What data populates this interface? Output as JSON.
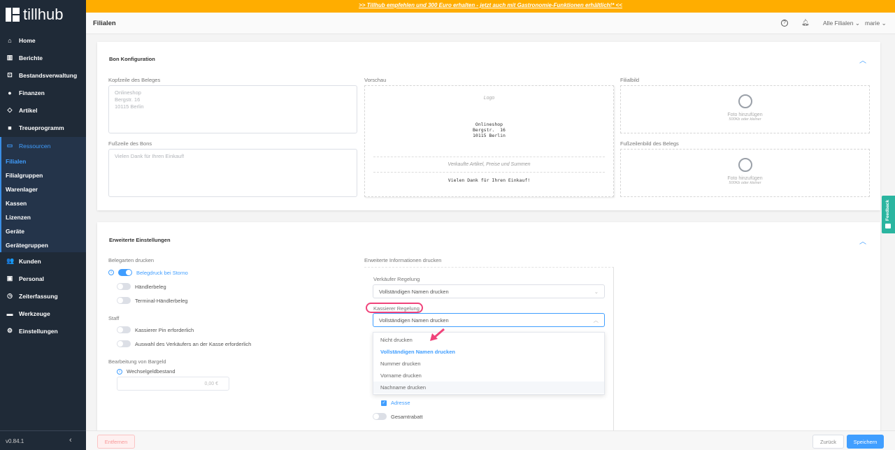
{
  "banner": ">> Tillhub empfehlen und 300 Euro erhalten - jetzt auch mit Gastronomie-Funktionen erhältlich!* <<",
  "brand": "tillhub",
  "sidebar": {
    "items": [
      {
        "label": "Home",
        "icon": "home-icon"
      },
      {
        "label": "Berichte",
        "icon": "chart-icon"
      },
      {
        "label": "Bestandsverwaltung",
        "icon": "inventory-icon"
      },
      {
        "label": "Finanzen",
        "icon": "piggy-bank-icon"
      },
      {
        "label": "Artikel",
        "icon": "tag-icon"
      },
      {
        "label": "Treueprogramm",
        "icon": "gift-icon"
      },
      {
        "label": "Ressourcen",
        "icon": "monitor-icon"
      }
    ],
    "sub_items": [
      "Filialen",
      "Filialgruppen",
      "Warenlager",
      "Kassen",
      "Lizenzen",
      "Geräte",
      "Gerätegruppen"
    ],
    "items2": [
      {
        "label": "Kunden",
        "icon": "users-icon"
      },
      {
        "label": "Personal",
        "icon": "id-card-icon"
      },
      {
        "label": "Zeiterfassung",
        "icon": "clock-icon"
      },
      {
        "label": "Werkzeuge",
        "icon": "folder-icon"
      },
      {
        "label": "Einstellungen",
        "icon": "gear-icon"
      }
    ],
    "version": "v0.84.1"
  },
  "header": {
    "title": "Filialen",
    "branch_select": "Alle Filialen",
    "user": "marie"
  },
  "bon": {
    "title": "Bon Konfiguration",
    "header_label": "Kopfzeile des Beleges",
    "header_lines": [
      "Onlineshop",
      "Bergstr. 16",
      "10115 Berlin"
    ],
    "footer_label": "Fußzeile des Bons",
    "footer_placeholder": "Vielen Dank für Ihren Einkauf!",
    "preview_label": "Vorschau",
    "preview_logo": "Logo",
    "preview_lines": [
      "Onlineshop",
      "Bergstr.  16",
      "10115 Berlin"
    ],
    "preview_items": "Verkaufte Artikel, Preise und Summen",
    "preview_footer": "Vielen Dank für Ihren Einkauf!",
    "image_label": "Filialbild",
    "footer_image_label": "Fußzeilenbild des Belegs",
    "add_photo": "Foto hinzufügen",
    "size_hint": "500Kb oder kleiner"
  },
  "advanced": {
    "title": "Erweiterte Einstellungen",
    "receipt_types_label": "Belegarten drucken",
    "toggles": [
      {
        "label": "Belegdruck bei Storno",
        "on": true
      },
      {
        "label": "Händlerbeleg",
        "on": false
      },
      {
        "label": "Terminal-Händlerbeleg",
        "on": false
      }
    ],
    "staff_label": "Staff",
    "staff_toggles": [
      {
        "label": "Kassierer Pin erforderlich",
        "on": false
      },
      {
        "label": "Auswahl des Verkäufers an der Kasse erforderlich",
        "on": false
      }
    ],
    "cash_label": "Bearbeitung von Bargeld",
    "float_label": "Wechselgeldbestand",
    "float_value": "0,00 €",
    "extra_label": "Erweiterte Informationen drucken",
    "seller_label": "Verkäufer Regelung",
    "seller_value": "Vollständigen Namen drucken",
    "cashier_label": "Kassierer Regelung",
    "cashier_value": "Vollständigen Namen drucken",
    "options": [
      "Nicht drucken",
      "Vollständigen Namen drucken",
      "Nummer drucken",
      "Vorname drucken",
      "Nachname drucken"
    ],
    "address_label": "Adresse",
    "discount_label": "Gesamtrabatt"
  },
  "footer": {
    "remove": "Entfernen",
    "back": "Zurück",
    "save": "Speichern"
  },
  "feedback": "Feedback",
  "colors": {
    "accent": "#409eff",
    "banner": "#ffad00",
    "sidebar": "#1f2a37",
    "highlight": "#f0437a"
  }
}
